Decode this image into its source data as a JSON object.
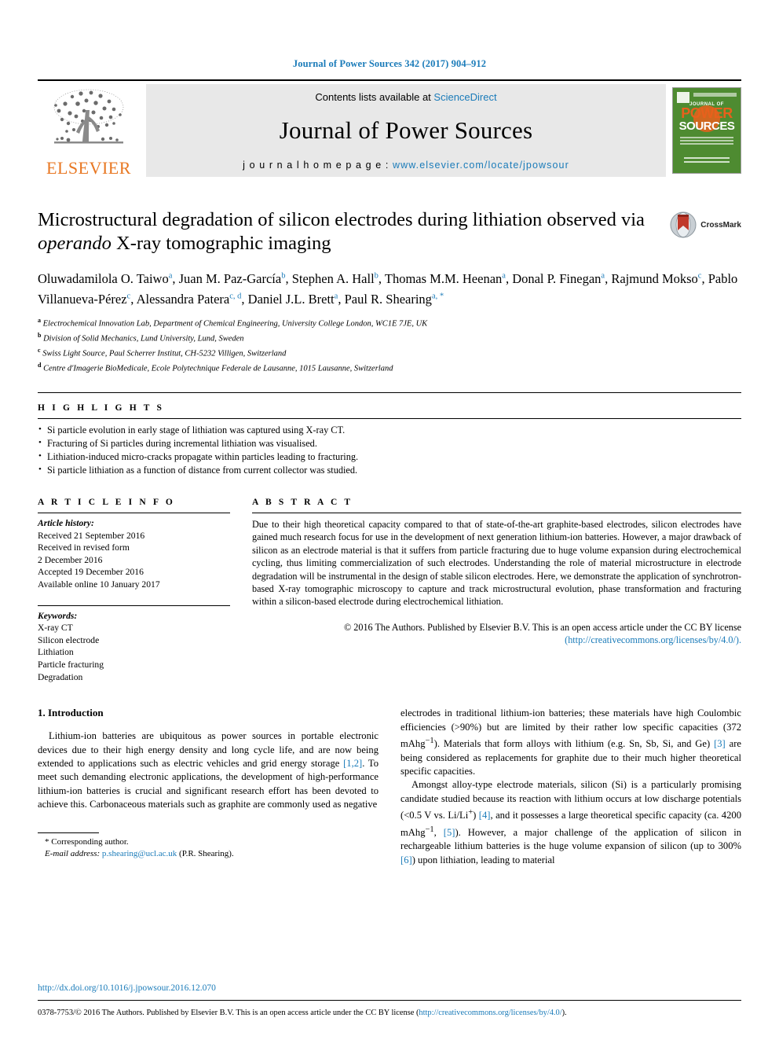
{
  "journal_ref": "Journal of Power Sources 342 (2017) 904–912",
  "masthead": {
    "publisher_logo_label": "ELSEVIER",
    "contents_prefix": "Contents lists available at ",
    "contents_link": "ScienceDirect",
    "journal_title": "Journal of Power Sources",
    "homepage_label": "j o u r n a l   h o m e p a g e :   ",
    "homepage_url": "www.elsevier.com/locate/jpowsour",
    "cover": {
      "elsevier_mark": "Elsevier",
      "journal_of": "JOURNAL OF",
      "power": "POWER",
      "sources": "SOURCES",
      "tagline": "The International Journal on the Science and Technology of Electrochemical Energy Systems",
      "publisher": "Published by Elsevier"
    }
  },
  "article": {
    "title_part1": "Microstructural degradation of silicon electrodes during lithiation observed via ",
    "title_italic": "operando",
    "title_part2": " X-ray tomographic imaging",
    "crossmark_label": "CrossMark",
    "authors": [
      {
        "name": "Oluwadamilola O. Taiwo",
        "sup": "a",
        "sep": ", "
      },
      {
        "name": "Juan M. Paz-García",
        "sup": "b",
        "sep": ", "
      },
      {
        "name": "Stephen A. Hall",
        "sup": "b",
        "sep": ", "
      },
      {
        "name": "Thomas M.M. Heenan",
        "sup": "a",
        "sep": ", "
      },
      {
        "name": "Donal P. Finegan",
        "sup": "a",
        "sep": ", "
      },
      {
        "name": "Rajmund Mokso",
        "sup": "c",
        "sep": ", "
      },
      {
        "name": "Pablo Villanueva-Pérez",
        "sup": "c",
        "sep": ", "
      },
      {
        "name": "Alessandra Patera",
        "sup": "c, d",
        "sep": ", "
      },
      {
        "name": "Daniel J.L. Brett",
        "sup": "a",
        "sep": ", "
      },
      {
        "name": "Paul R. Shearing",
        "sup": "a, *",
        "sep": ""
      }
    ],
    "affiliations": [
      {
        "marker": "a",
        "text": "Electrochemical Innovation Lab, Department of Chemical Engineering, University College London, WC1E 7JE, UK"
      },
      {
        "marker": "b",
        "text": "Division of Solid Mechanics, Lund University, Lund, Sweden"
      },
      {
        "marker": "c",
        "text": "Swiss Light Source, Paul Scherrer Institut, CH-5232 Villigen, Switzerland"
      },
      {
        "marker": "d",
        "text": "Centre d'Imagerie BioMedicale, Ecole Polytechnique Federale de Lausanne, 1015 Lausanne, Switzerland"
      }
    ]
  },
  "highlights": {
    "heading": "H I G H L I G H T S",
    "items": [
      "Si particle evolution in early stage of lithiation was captured using X-ray CT.",
      "Fracturing of Si particles during incremental lithiation was visualised.",
      "Lithiation-induced micro-cracks propagate within particles leading to fracturing.",
      "Si particle lithiation as a function of distance from current collector was studied."
    ]
  },
  "article_info": {
    "heading": "A R T I C L E   I N F O",
    "history_label": "Article history:",
    "history": [
      "Received 21 September 2016",
      "Received in revised form",
      "2 December 2016",
      "Accepted 19 December 2016",
      "Available online 10 January 2017"
    ],
    "keywords_label": "Keywords:",
    "keywords": [
      "X-ray CT",
      "Silicon electrode",
      "Lithiation",
      "Particle fracturing",
      "Degradation"
    ]
  },
  "abstract": {
    "heading": "A B S T R A C T",
    "text": "Due to their high theoretical capacity compared to that of state-of-the-art graphite-based electrodes, silicon electrodes have gained much research focus for use in the development of next generation lithium-ion batteries. However, a major drawback of silicon as an electrode material is that it suffers from particle fracturing due to huge volume expansion during electrochemical cycling, thus limiting commercialization of such electrodes. Understanding the role of material microstructure in electrode degradation will be instrumental in the design of stable silicon electrodes. Here, we demonstrate the application of synchrotron-based X-ray tomographic microscopy to capture and track microstructural evolution, phase transformation and fracturing within a silicon-based electrode during electrochemical lithiation.",
    "copyright": "© 2016 The Authors. Published by Elsevier B.V. This is an open access article under the CC BY license",
    "license_url": "(http://creativecommons.org/licenses/by/4.0/)."
  },
  "body": {
    "section_title": "1. Introduction",
    "left_paragraph_a": "Lithium-ion batteries are ubiquitous as power sources in portable electronic devices due to their high energy density and long cycle life, and are now being extended to applications such as electric vehicles and grid energy storage ",
    "left_ref_1": "[1,2]",
    "left_paragraph_b": ". To meet such demanding electronic applications, the development of high-performance lithium-ion batteries is crucial and significant research effort has been devoted to achieve this. Carbonaceous materials such as graphite are commonly used as negative",
    "right_p1_a": "electrodes in traditional lithium-ion batteries; these materials have high Coulombic efficiencies (>90%) but are limited by their rather low specific capacities (372 mAhg",
    "right_p1_sup1": "−1",
    "right_p1_b": "). Materials that form alloys with lithium (e.g. Sn, Sb, Si, and Ge) ",
    "right_ref_3": "[3]",
    "right_p1_c": " are being considered as replacements for graphite due to their much higher theoretical specific capacities.",
    "right_p2_a": "Amongst alloy-type electrode materials, silicon (Si) is a particularly promising candidate studied because its reaction with lithium occurs at low discharge potentials (<0.5 V vs. Li/Li",
    "right_p2_sup1": "+",
    "right_p2_b": ") ",
    "right_ref_4": "[4]",
    "right_p2_c": ", and it possesses a large theoretical specific capacity (ca. 4200 mAhg",
    "right_p2_sup2": "−1",
    "right_p2_d": ", ",
    "right_ref_5": "[5]",
    "right_p2_e": "). However, a major challenge of the application of silicon in rechargeable lithium batteries is the huge volume expansion of silicon (up to 300% ",
    "right_ref_6": "[6]",
    "right_p2_f": ") upon lithiation, leading to material"
  },
  "footer": {
    "corresponding_marker": "*",
    "corresponding_label": "Corresponding author.",
    "email_label": "E-mail address:",
    "email": "p.shearing@ucl.ac.uk",
    "email_owner": "(P.R. Shearing).",
    "doi": "http://dx.doi.org/10.1016/j.jpowsour.2016.12.070",
    "issn_copyright": "0378-7753/© 2016 The Authors. Published by Elsevier B.V. This is an open access article under the CC BY license (",
    "issn_license_url": "http://creativecommons.org/licenses/by/4.0/",
    "issn_copyright_end": ")."
  },
  "colors": {
    "link": "#1a7bb9",
    "elsevier_orange": "#e87722",
    "cover_green": "#4e8b31"
  }
}
